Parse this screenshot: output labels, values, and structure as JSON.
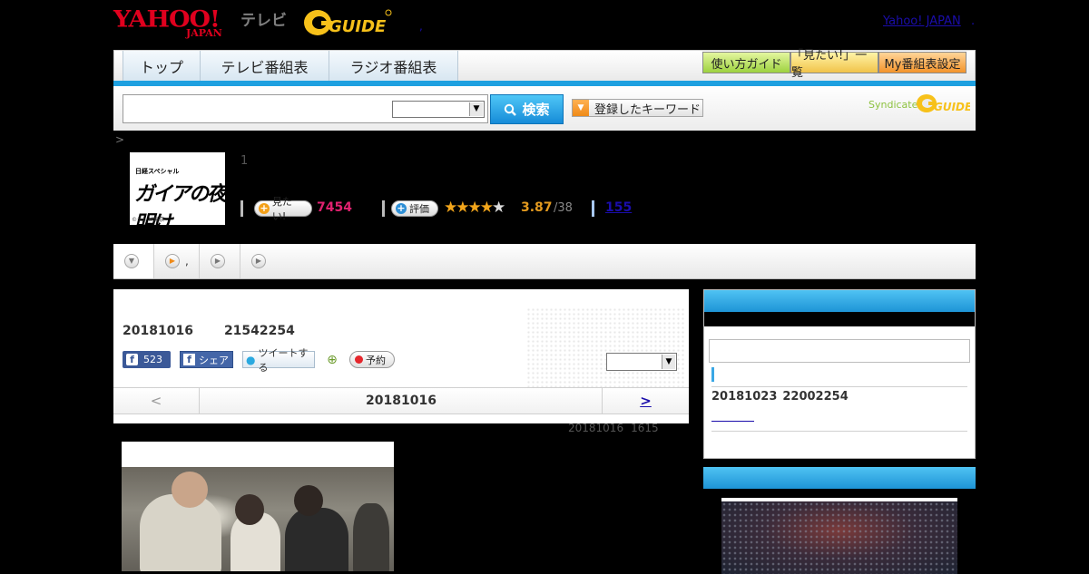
{
  "header": {
    "yahoo_logo": "YAHOO!",
    "yahoo_logo_sub": "JAPAN",
    "tv_label": "テレビ",
    "gguide_logo": "G-GUIDE",
    "yahoo_japan_link": "Yahoo! JAPAN",
    "dot": ".",
    "hdr_dot": ","
  },
  "nav": {
    "tabs": [
      "トップ",
      "テレビ番組表",
      "ラジオ番組表"
    ],
    "buttons": [
      "使い方ガイド",
      "「見たい!」一覧",
      "My番組表設定"
    ],
    "accent_color": "#1ea0e0"
  },
  "search": {
    "input_value": "",
    "select_value": "",
    "button_label": "検索",
    "keyword_button_label": "登録したキーワード",
    "syndicated_label": "Syndicated"
  },
  "breadcrumb": ">",
  "program": {
    "image_caption_top": "日経スペシャル",
    "image_title": "ガイアの夜明け",
    "image_copyright": "©テレビ東京",
    "episode_num": "1",
    "want_label": "見たい!",
    "want_count": "7454",
    "rate_label": "評価",
    "stars_filled": "★★★★",
    "stars_empty": "★",
    "rating": "3.87",
    "rating_count": "/38",
    "reviews": "155"
  },
  "tabs": {
    "items": [
      "",
      ",",
      "",
      ""
    ]
  },
  "main": {
    "date": "20181016",
    "time": "21542254",
    "fb_like_count": "523",
    "fb_share_label": "シェア",
    "tweet_label": "ツイートする",
    "reserve_label": "予約",
    "select_value": "",
    "pager_prev": "<",
    "pager_current": "20181016",
    "pager_next": ">",
    "updated_date": "20181016",
    "updated_time": "1615"
  },
  "sidebar": {
    "next_date": "20181023",
    "next_time": "22002254"
  }
}
